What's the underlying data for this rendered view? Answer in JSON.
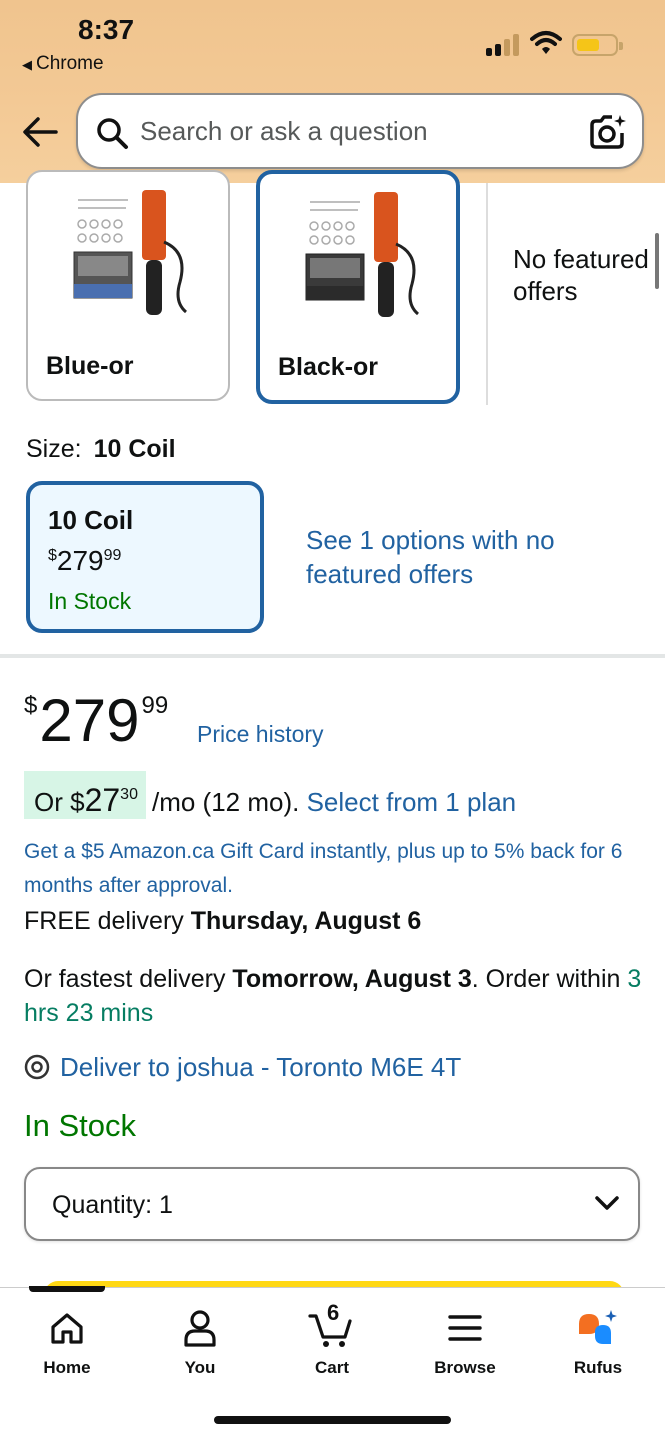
{
  "status_bar": {
    "time": "8:37",
    "back_app": "Chrome"
  },
  "search": {
    "placeholder": "Search or ask a question"
  },
  "colors": {
    "accent": "#2162a1",
    "in_stock": "#007600",
    "highlight_green": "#d7f5e6",
    "header_bg": "#f3c995"
  },
  "color_options": [
    {
      "label": "Blue-or",
      "selected": false
    },
    {
      "label": "Black-or",
      "selected": true
    }
  ],
  "no_featured": "No featured offers",
  "size": {
    "label": "Size:",
    "value": "10 Coil",
    "card": {
      "title": "10 Coil",
      "currency": "$",
      "price_whole": "279",
      "price_cents": "99",
      "stock": "In Stock"
    },
    "see_options": "See 1 options with no featured offers"
  },
  "price": {
    "currency": "$",
    "whole": "279",
    "cents": "99",
    "history_link": "Price history"
  },
  "monthly": {
    "prefix": "Or $",
    "amount": "27",
    "cents": "30",
    "term": "/mo (12 mo).",
    "link": "Select from 1 plan"
  },
  "gift_card_text": "Get a $5 Amazon.ca Gift Card instantly, plus up to 5% back for 6 months after approval.",
  "delivery": {
    "free_prefix": "FREE delivery ",
    "free_date": "Thursday, August 6",
    "fast_prefix": "Or fastest delivery ",
    "fast_date": "Tomorrow, August 3",
    "fast_mid": ". Order within ",
    "countdown": "3 hrs 23 mins",
    "deliver_to": "Deliver to joshua - Toronto M6E 4T"
  },
  "stock_status": "In Stock",
  "quantity": {
    "label": "Quantity:",
    "value": "1"
  },
  "bottom_nav": {
    "home": "Home",
    "you": "You",
    "cart": "Cart",
    "cart_count": "6",
    "browse": "Browse",
    "rufus": "Rufus"
  }
}
